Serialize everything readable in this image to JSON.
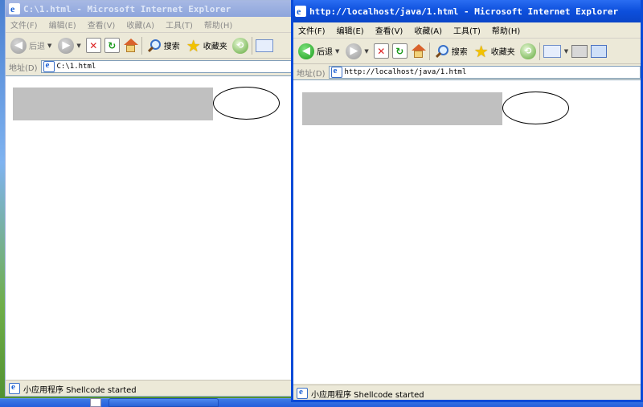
{
  "left_window": {
    "title": "C:\\1.html - Microsoft Internet Explorer",
    "menu": [
      "文件(F)",
      "编辑(E)",
      "查看(V)",
      "收藏(A)",
      "工具(T)",
      "帮助(H)"
    ],
    "toolbar": {
      "back": "后退",
      "search": "搜索",
      "favorites": "收藏夹"
    },
    "address_label": "地址(D)",
    "address_value": "C:\\1.html",
    "status": "小应用程序 Shellcode started"
  },
  "right_window": {
    "title": "http://localhost/java/1.html - Microsoft Internet Explorer",
    "menu": [
      "文件(F)",
      "编辑(E)",
      "查看(V)",
      "收藏(A)",
      "工具(T)",
      "帮助(H)"
    ],
    "toolbar": {
      "back": "后退",
      "search": "搜索",
      "favorites": "收藏夹"
    },
    "address_label": "地址(D)",
    "address_value": "http://localhost/java/1.html",
    "status": "小应用程序 Shellcode started"
  },
  "colors": {
    "active_title": "#0d4fdc",
    "inactive_title": "#8da5dc",
    "window_face": "#ece9d8",
    "applet_rect": "#c0c0c0"
  },
  "icons": [
    "back-icon",
    "forward-icon",
    "stop-icon",
    "refresh-icon",
    "home-icon",
    "search-icon",
    "favorites-icon",
    "history-icon",
    "mail-icon",
    "print-icon",
    "edit-icon",
    "ie-page-icon"
  ]
}
